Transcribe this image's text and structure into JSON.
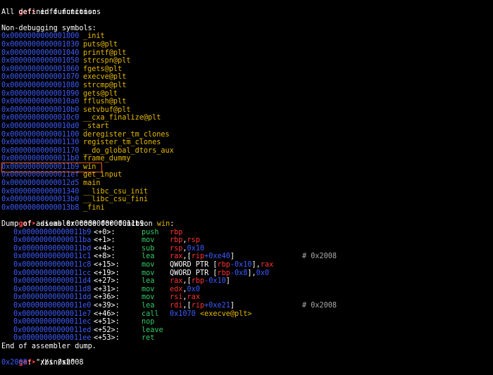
{
  "prompt_label": "gef➤",
  "cmd1": "info functions",
  "all_defined": "All defined functions:",
  "non_debugging": "Non-debugging symbols:",
  "functions": [
    {
      "addr": "0x0000000000001000",
      "name": "_init"
    },
    {
      "addr": "0x0000000000001030",
      "name": "puts@plt"
    },
    {
      "addr": "0x0000000000001040",
      "name": "printf@plt"
    },
    {
      "addr": "0x0000000000001050",
      "name": "strcspn@plt"
    },
    {
      "addr": "0x0000000000001060",
      "name": "fgets@plt"
    },
    {
      "addr": "0x0000000000001070",
      "name": "execve@plt"
    },
    {
      "addr": "0x0000000000001080",
      "name": "strcmp@plt"
    },
    {
      "addr": "0x0000000000001090",
      "name": "gets@plt"
    },
    {
      "addr": "0x00000000000010a0",
      "name": "fflush@plt"
    },
    {
      "addr": "0x00000000000010b0",
      "name": "setvbuf@plt"
    },
    {
      "addr": "0x00000000000010c0",
      "name": "__cxa_finalize@plt"
    },
    {
      "addr": "0x00000000000010d0",
      "name": "_start"
    },
    {
      "addr": "0x0000000000001100",
      "name": "deregister_tm_clones"
    },
    {
      "addr": "0x0000000000001130",
      "name": "register_tm_clones"
    },
    {
      "addr": "0x0000000000001170",
      "name": "__do_global_dtors_aux"
    },
    {
      "addr": "0x00000000000011b0",
      "name": "frame_dummy"
    },
    {
      "addr": "0x00000000000011b9",
      "name": "win"
    },
    {
      "addr": "0x00000000000011ef",
      "name": "get_input"
    },
    {
      "addr": "0x00000000000012d5",
      "name": "main"
    },
    {
      "addr": "0x0000000000001340",
      "name": "__libc_csu_init"
    },
    {
      "addr": "0x00000000000013b0",
      "name": "__libc_csu_fini"
    },
    {
      "addr": "0x00000000000013b8",
      "name": "_fini"
    }
  ],
  "cmd2": "disas 0x00000000000011b9",
  "dump_prefix": "Dump of assembler code for function ",
  "dump_func": "win",
  "dump_suffix": ":",
  "asm": [
    {
      "addr": "0x00000000000011b9",
      "off": "<+0>:",
      "mn": "push",
      "ops": [
        [
          "reg",
          "rbp"
        ]
      ],
      "cmt": ""
    },
    {
      "addr": "0x00000000000011ba",
      "off": "<+1>:",
      "mn": "mov",
      "ops": [
        [
          "reg",
          "rbp"
        ],
        [
          "w",
          ","
        ],
        [
          "reg",
          "rsp"
        ]
      ],
      "cmt": ""
    },
    {
      "addr": "0x00000000000011bd",
      "off": "<+4>:",
      "mn": "sub",
      "ops": [
        [
          "reg",
          "rsp"
        ],
        [
          "w",
          ","
        ],
        [
          "num",
          "0x10"
        ]
      ],
      "cmt": ""
    },
    {
      "addr": "0x00000000000011c1",
      "off": "<+8>:",
      "mn": "lea",
      "ops": [
        [
          "reg",
          "rax"
        ],
        [
          "w",
          ",["
        ],
        [
          "reg",
          "rip"
        ],
        [
          "num",
          "+0xe40"
        ],
        [
          "w",
          "]"
        ]
      ],
      "cmt": "# 0x2008"
    },
    {
      "addr": "0x00000000000011c8",
      "off": "<+15>:",
      "mn": "mov",
      "ops": [
        [
          "w",
          "QWORD PTR ["
        ],
        [
          "reg",
          "rbp"
        ],
        [
          "num",
          "-0x10"
        ],
        [
          "w",
          "],"
        ],
        [
          "reg",
          "rax"
        ]
      ],
      "cmt": ""
    },
    {
      "addr": "0x00000000000011cc",
      "off": "<+19>:",
      "mn": "mov",
      "ops": [
        [
          "w",
          "QWORD PTR ["
        ],
        [
          "reg",
          "rbp"
        ],
        [
          "num",
          "-0x8"
        ],
        [
          "w",
          "],"
        ],
        [
          "num",
          "0x0"
        ]
      ],
      "cmt": ""
    },
    {
      "addr": "0x00000000000011d4",
      "off": "<+27>:",
      "mn": "lea",
      "ops": [
        [
          "reg",
          "rax"
        ],
        [
          "w",
          ",["
        ],
        [
          "reg",
          "rbp"
        ],
        [
          "num",
          "-0x10"
        ],
        [
          "w",
          "]"
        ]
      ],
      "cmt": ""
    },
    {
      "addr": "0x00000000000011d8",
      "off": "<+31>:",
      "mn": "mov",
      "ops": [
        [
          "reg",
          "edx"
        ],
        [
          "w",
          ","
        ],
        [
          "num",
          "0x0"
        ]
      ],
      "cmt": ""
    },
    {
      "addr": "0x00000000000011dd",
      "off": "<+36>:",
      "mn": "mov",
      "ops": [
        [
          "reg",
          "rsi"
        ],
        [
          "w",
          ","
        ],
        [
          "reg",
          "rax"
        ]
      ],
      "cmt": ""
    },
    {
      "addr": "0x00000000000011e0",
      "off": "<+39>:",
      "mn": "lea",
      "ops": [
        [
          "reg",
          "rdi"
        ],
        [
          "w",
          ",["
        ],
        [
          "reg",
          "rip"
        ],
        [
          "num",
          "+0xe21"
        ],
        [
          "w",
          "]"
        ]
      ],
      "cmt": "# 0x2008"
    },
    {
      "addr": "0x00000000000011e7",
      "off": "<+46>:",
      "mn": "call",
      "ops": [
        [
          "num",
          "0x1070 "
        ],
        [
          "func",
          "<execve@plt>"
        ]
      ],
      "cmt": ""
    },
    {
      "addr": "0x00000000000011ec",
      "off": "<+51>:",
      "mn": "nop",
      "ops": [],
      "cmt": ""
    },
    {
      "addr": "0x00000000000011ed",
      "off": "<+52>:",
      "mn": "leave",
      "ops": [],
      "cmt": ""
    },
    {
      "addr": "0x00000000000011ee",
      "off": "<+53>:",
      "mn": "ret",
      "ops": [],
      "cmt": ""
    }
  ],
  "end_dump": "End of assembler dump.",
  "cmd3": "x/s 0x2008",
  "xs_addr": "0x2008",
  "xs_sep": ":",
  "xs_value": "\"/bin/sh\""
}
